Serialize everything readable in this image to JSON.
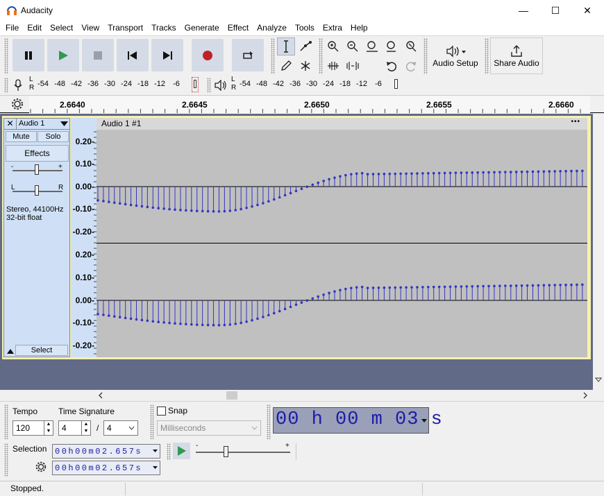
{
  "window": {
    "title": "Audacity",
    "minimize": "—",
    "maximize": "☐",
    "close": "✕"
  },
  "menu": [
    "File",
    "Edit",
    "Select",
    "View",
    "Transport",
    "Tracks",
    "Generate",
    "Effect",
    "Analyze",
    "Tools",
    "Extra",
    "Help"
  ],
  "toolbar": {
    "audio_setup_label": "Audio Setup",
    "share_audio_label": "Share Audio"
  },
  "meters": {
    "record_scale": [
      "-54",
      "-48",
      "-42",
      "-36",
      "-30",
      "-24",
      "-18",
      "-12",
      "-6"
    ],
    "play_scale": [
      "-54",
      "-48",
      "-42",
      "-36",
      "-30",
      "-24",
      "-18",
      "-12",
      "-6"
    ],
    "channel_left": "L",
    "channel_right": "R"
  },
  "ruler": {
    "ticks": [
      "2.6640",
      "2.6645",
      "2.6650",
      "2.6655",
      "2.6660"
    ]
  },
  "track": {
    "name": "Audio 1",
    "mute_label": "Mute",
    "solo_label": "Solo",
    "effects_label": "Effects",
    "gain_min": "-",
    "gain_max": "+",
    "pan_left": "L",
    "pan_right": "R",
    "format_line1": "Stereo, 44100Hz",
    "format_line2": "32-bit float",
    "select_label": "Select",
    "clip_name": "Audio 1 #1",
    "clip_menu": "•••",
    "scale_labels": [
      "0.20-",
      "0.10-",
      "0.00-",
      "-0.10-",
      "-0.20-"
    ],
    "wave_color": "#3535c0"
  },
  "bottom": {
    "tempo_label": "Tempo",
    "tempo_value": "120",
    "time_signature_label": "Time Signature",
    "ts_numerator": "4",
    "ts_slash": "/",
    "ts_denominator": "4",
    "snap_label": "Snap",
    "snap_units": "Milliseconds",
    "selection_label": "Selection",
    "selection_start": "00h00m02.657s",
    "selection_end": "00h00m02.657s",
    "time_display": "00 h 00 m 03 s",
    "play_speed_min": "-",
    "play_speed_max": "+"
  },
  "status": {
    "text": "Stopped."
  }
}
